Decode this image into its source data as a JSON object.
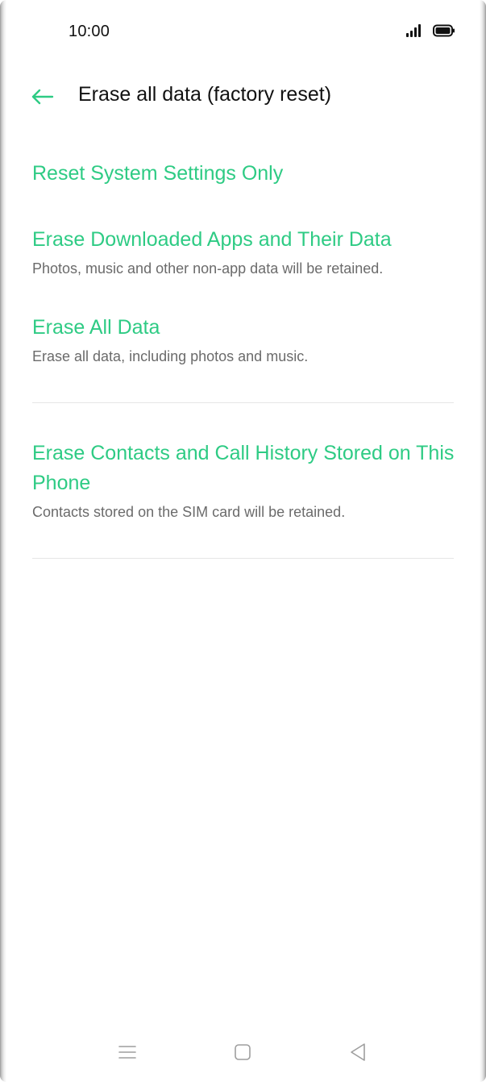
{
  "status_bar": {
    "time": "10:00",
    "signal_icon": "signal-bars-icon",
    "battery_icon": "battery-icon"
  },
  "header": {
    "back_icon": "arrow-left-icon",
    "title": "Erase all data (factory reset)"
  },
  "options": [
    {
      "title": "Reset System Settings Only",
      "description": ""
    },
    {
      "title": "Erase Downloaded Apps and Their Data",
      "description": "Photos, music and other non-app data will be retained."
    },
    {
      "title": "Erase All Data",
      "description": "Erase all data, including photos and music."
    },
    {
      "title": "Erase Contacts and Call History Stored on This Phone",
      "description": "Contacts stored on the SIM card will be retained."
    }
  ],
  "nav_bar": {
    "menu_icon": "menu-lines-icon",
    "home_icon": "home-square-icon",
    "back_icon": "back-triangle-icon"
  },
  "colors": {
    "accent": "#2ecb84",
    "title_text": "#111111",
    "secondary_text": "#6b6b6b",
    "divider": "#e6e6e6",
    "nav_icon": "#9e9e9e"
  }
}
